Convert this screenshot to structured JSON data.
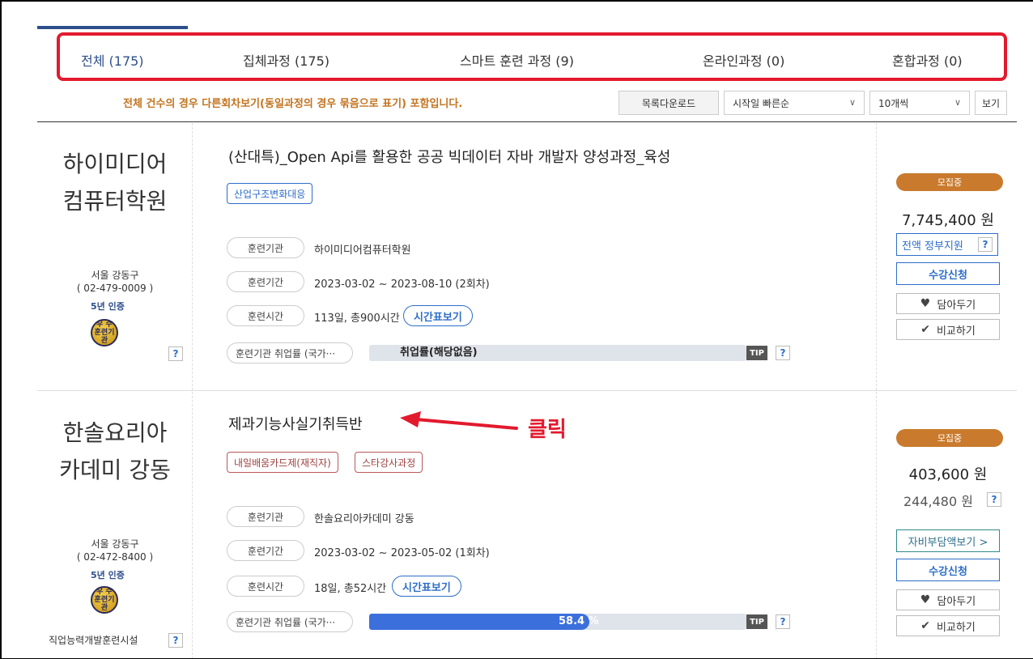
{
  "tabs": [
    {
      "label": "전체 (175)"
    },
    {
      "label": "집체과정 (175)"
    },
    {
      "label": "스마트 훈련 과정 (9)"
    },
    {
      "label": "온라인과정 (0)"
    },
    {
      "label": "혼합과정 (0)"
    }
  ],
  "toolbar": {
    "notice": "전체 건수의 경우 다른회차보기(동일과정의 경우 묶음으로 표기) 포함입니다.",
    "download_label": "목록다운로드",
    "sort_value": "시작일 빠른순",
    "page_size_value": "10개씩",
    "view_label": "보기"
  },
  "courses": [
    {
      "institution_line1": "하이미디어",
      "institution_line2": "컴퓨터학원",
      "location": "서울 강동구",
      "phone": "( 02-479-0009 )",
      "cert_years": "5년 인증",
      "badge_text": "우 수 훈련기관",
      "institution_type": "",
      "title": "(산대특)_Open Api를 활용한 공공 빅데이터 자바 개발자 양성과정_육성",
      "tags": [
        "산업구조변화대응"
      ],
      "label_org": "훈련기관",
      "org": "하이미디어컴퓨터학원",
      "label_period": "훈련기간",
      "period": "2023-03-02 ~ 2023-08-10 (2회차)",
      "label_hours": "훈련시간",
      "hours": "113일, 총900시간",
      "timetable_label": "시간표보기",
      "label_employment": "훈련기관 취업률 (국가···",
      "employment_text": "취업률(해당없음)",
      "employment_rate": 0,
      "tip_label": "TIP",
      "status": "모집중",
      "price": "7,745,400 원",
      "price_sub": "",
      "support_label": "전액 정부지원",
      "self_pay_label": "",
      "apply_label": "수강신청",
      "wishlist_label": "담아두기",
      "compare_label": "비교하기"
    },
    {
      "institution_line1": "한솔요리아",
      "institution_line2": "카데미 강동",
      "location": "서울 강동구",
      "phone": "( 02-472-8400 )",
      "cert_years": "5년 인증",
      "badge_text": "우 수 훈련기관",
      "institution_type": "직업능력개발훈련시설",
      "title": "제과기능사실기취득반",
      "tags": [
        "내일배움카드제(재직자)",
        "스타강사과정"
      ],
      "label_org": "훈련기관",
      "org": "한솔요리아카데미 강동",
      "label_period": "훈련기간",
      "period": "2023-03-02 ~ 2023-05-02 (1회차)",
      "label_hours": "훈련시간",
      "hours": "18일, 총52시간",
      "timetable_label": "시간표보기",
      "label_employment": "훈련기관 취업률 (국가···",
      "employment_text": "58.4 %",
      "employment_rate": 58.4,
      "tip_label": "TIP",
      "status": "모집중",
      "price": "403,600 원",
      "price_sub": "244,480 원",
      "support_label": "",
      "self_pay_label": "자비부담액보기 >",
      "apply_label": "수강신청",
      "wishlist_label": "담아두기",
      "compare_label": "비교하기"
    }
  ],
  "annotation": {
    "click_label": "클릭"
  },
  "colors": {
    "highlight_red": "#e21a2d",
    "brand_blue": "#2d4f8b",
    "status_orange": "#c97a2c",
    "bar_blue": "#3b6fdc"
  }
}
